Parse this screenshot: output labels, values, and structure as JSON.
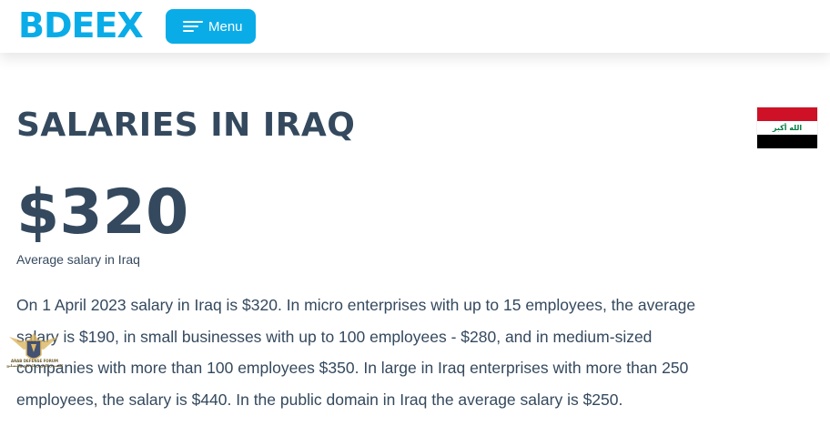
{
  "header": {
    "logo_text": "BDEEX",
    "menu_label": "Menu",
    "menu_icon": "hamburger-menu-icon"
  },
  "page": {
    "title": "SALARIES IN IRAQ",
    "flag": {
      "name": "iraq-flag-icon",
      "inscription": "الله أكبر"
    },
    "average_salary": "$320",
    "average_caption": "Average salary in Iraq",
    "description": "On 1 April 2023 salary in Iraq is $320. In micro enterprises with up to 15 employees, the average salary is $190, in small businesses with up to 100 employees - $280, and in medium-sized companies with more than 100 employees $350. In large in Iraq enterprises with more than 250 employees, the salary is $440. In the public domain in Iraq the average salary is $250."
  },
  "watermark": {
    "icon": "arab-defense-forum-emblem-icon",
    "line1": "ARAB DEFENSE FORUM",
    "line2": "المنتدى العربي للدفاع والتسليح"
  },
  "colors": {
    "brand": "#0aace8",
    "text": "#34495e",
    "flag_red": "#ce1126",
    "flag_white": "#ffffff",
    "flag_black": "#000000",
    "flag_green": "#007a3d"
  }
}
